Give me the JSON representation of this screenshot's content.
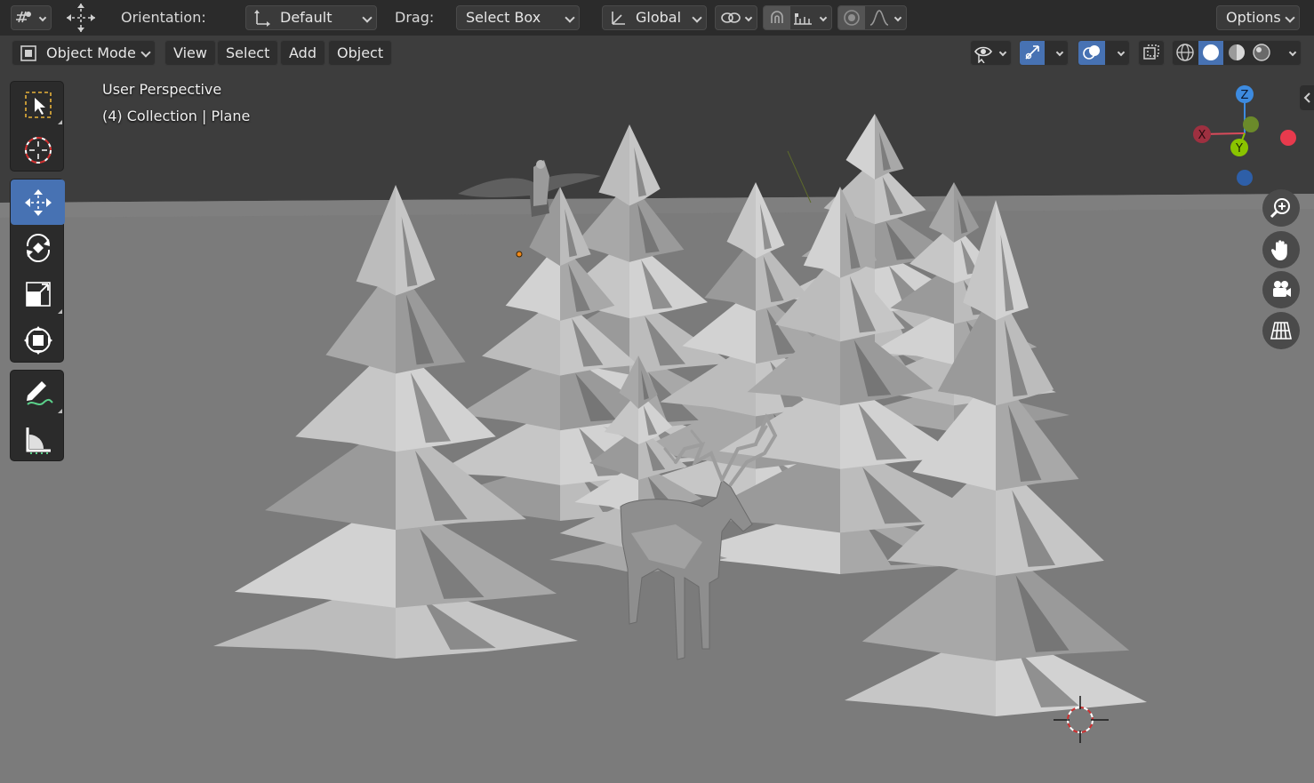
{
  "tool_header": {
    "orientation_label": "Orientation:",
    "orientation_value": "Default",
    "drag_label": "Drag:",
    "drag_value": "Select Box",
    "transform_orientation": "Global",
    "options_label": "Options"
  },
  "view_header": {
    "mode": "Object Mode",
    "menus": [
      "View",
      "Select",
      "Add",
      "Object"
    ]
  },
  "viewport": {
    "perspective": "User Perspective",
    "collection": "(4) Collection | Plane"
  },
  "gizmo": {
    "z": "Z",
    "x": "X",
    "y": "Y"
  },
  "toolbar": {
    "tools": [
      "select-box",
      "cursor",
      "move",
      "rotate",
      "scale",
      "transform",
      "annotate",
      "measure"
    ],
    "active_tool": "move"
  },
  "colors": {
    "header": "#2b2b2b",
    "accent": "#4772b3",
    "floor": "#7a7a7a",
    "sky": "#3d3d3d",
    "axis_x": "#d94b5b",
    "axis_y": "#8ac400",
    "axis_z": "#3d8be0"
  }
}
